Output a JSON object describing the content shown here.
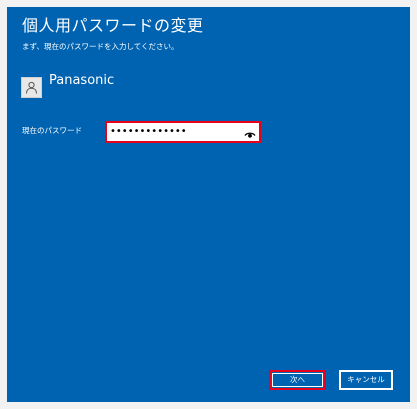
{
  "dialog": {
    "title": "個人用パスワードの変更",
    "subtitle": "まず、現在のパスワードを入力してください。"
  },
  "account": {
    "name": "Panasonic",
    "avatar_icon": "user-icon"
  },
  "password_field": {
    "label": "現在のパスワード",
    "value": "•••••••••••••",
    "reveal_icon": "eye-icon",
    "highlight_color": "#e8001c"
  },
  "buttons": {
    "next_label": "次へ",
    "cancel_label": "キャンセル"
  },
  "colors": {
    "background": "#0063b1",
    "text": "#ffffff",
    "highlight": "#e8001c"
  }
}
